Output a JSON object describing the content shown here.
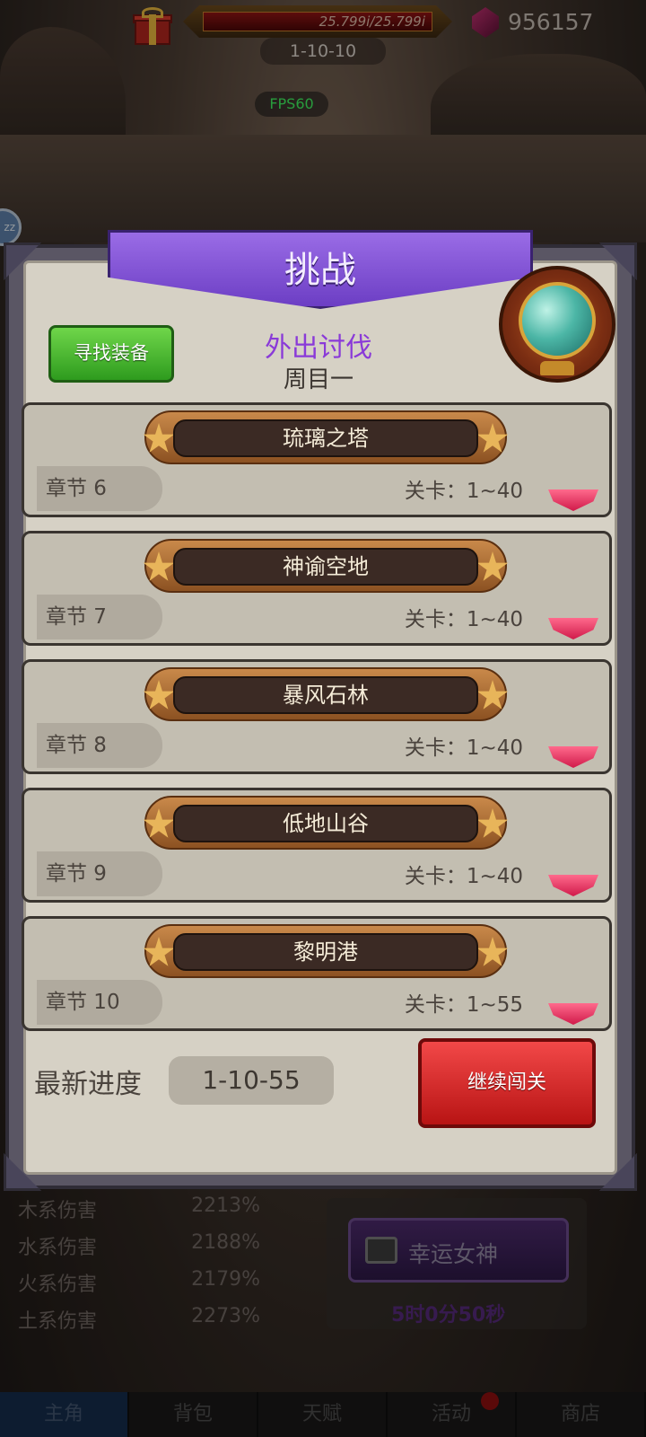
{
  "hud": {
    "hp_text": "25.799i/25.799i",
    "gems": "956157",
    "stage": "1-10-10",
    "fps": "FPS60",
    "sleep_badge": "zz"
  },
  "panel": {
    "title": "挑战",
    "find_equipment": "寻找装备",
    "subtitle": "外出讨伐",
    "round": "周目一",
    "chapters": [
      {
        "name": "琉璃之塔",
        "chapter": "章节  6",
        "levels": "关卡：1~40"
      },
      {
        "name": "神谕空地",
        "chapter": "章节  7",
        "levels": "关卡：1~40"
      },
      {
        "name": "暴风石林",
        "chapter": "章节  8",
        "levels": "关卡：1~40"
      },
      {
        "name": "低地山谷",
        "chapter": "章节  9",
        "levels": "关卡：1~40"
      },
      {
        "name": "黎明港",
        "chapter": "章节  10",
        "levels": "关卡：1~55"
      }
    ],
    "progress_label": "最新进度",
    "progress_value": "1-10-55",
    "continue": "继续闯关"
  },
  "stats": [
    {
      "label": "木系伤害",
      "value": "2213%"
    },
    {
      "label": "水系伤害",
      "value": "2188%"
    },
    {
      "label": "火系伤害",
      "value": "2179%"
    },
    {
      "label": "土系伤害",
      "value": "2273%"
    }
  ],
  "fortune": {
    "label": "幸运女神",
    "timer": "5时0分50秒"
  },
  "nav": [
    "主角",
    "背包",
    "天赋",
    "活动",
    "商店"
  ]
}
